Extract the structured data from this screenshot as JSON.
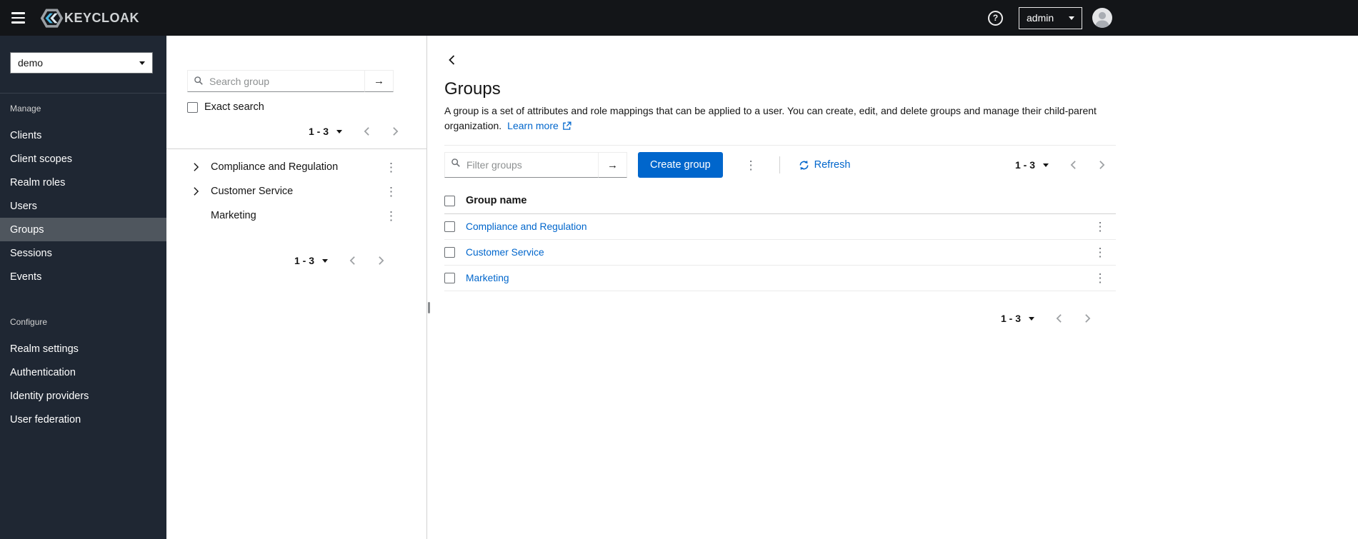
{
  "colors": {
    "primary": "#0066cc",
    "link": "#0066cc",
    "masthead_bg": "#131518",
    "sidebar_bg": "#1f2733",
    "sidebar_selected_bg": "#4f565e"
  },
  "icons": {
    "help_glyph": "?",
    "arrow_right_glyph": "→",
    "kebab_glyph": "⋮"
  },
  "masthead": {
    "brand_text": "KEYCLOAK",
    "user_menu": {
      "label": "admin"
    }
  },
  "sidebar": {
    "realm_selector": {
      "value": "demo"
    },
    "manage_section": {
      "label": "Manage",
      "items": [
        {
          "label": "Clients"
        },
        {
          "label": "Client scopes"
        },
        {
          "label": "Realm roles"
        },
        {
          "label": "Users"
        },
        {
          "label": "Groups",
          "selected": true
        },
        {
          "label": "Sessions"
        },
        {
          "label": "Events"
        }
      ]
    },
    "configure_section": {
      "label": "Configure",
      "items": [
        {
          "label": "Realm settings"
        },
        {
          "label": "Authentication"
        },
        {
          "label": "Identity providers"
        },
        {
          "label": "User federation"
        }
      ]
    }
  },
  "tree_panel": {
    "search": {
      "placeholder": "Search group"
    },
    "exact_search_label": "Exact search",
    "pagination_top": {
      "range": "1 - 3"
    },
    "items": [
      {
        "label": "Compliance and Regulation",
        "expandable": true
      },
      {
        "label": "Customer Service",
        "expandable": true
      },
      {
        "label": "Marketing",
        "expandable": false
      }
    ],
    "pagination_bottom": {
      "range": "1 - 3"
    }
  },
  "main": {
    "title": "Groups",
    "description": "A group is a set of attributes and role mappings that can be applied to a user. You can create, edit, and delete groups and manage their child-parent organization.",
    "learn_more_label": "Learn more",
    "toolbar": {
      "filter": {
        "placeholder": "Filter groups"
      },
      "create_button_label": "Create group",
      "refresh_label": "Refresh",
      "pagination": {
        "range": "1 - 3"
      }
    },
    "table": {
      "column_header": "Group name",
      "rows": [
        {
          "name": "Compliance and Regulation"
        },
        {
          "name": "Customer Service"
        },
        {
          "name": "Marketing"
        }
      ]
    },
    "pagination_bottom": {
      "range": "1 - 3"
    }
  }
}
